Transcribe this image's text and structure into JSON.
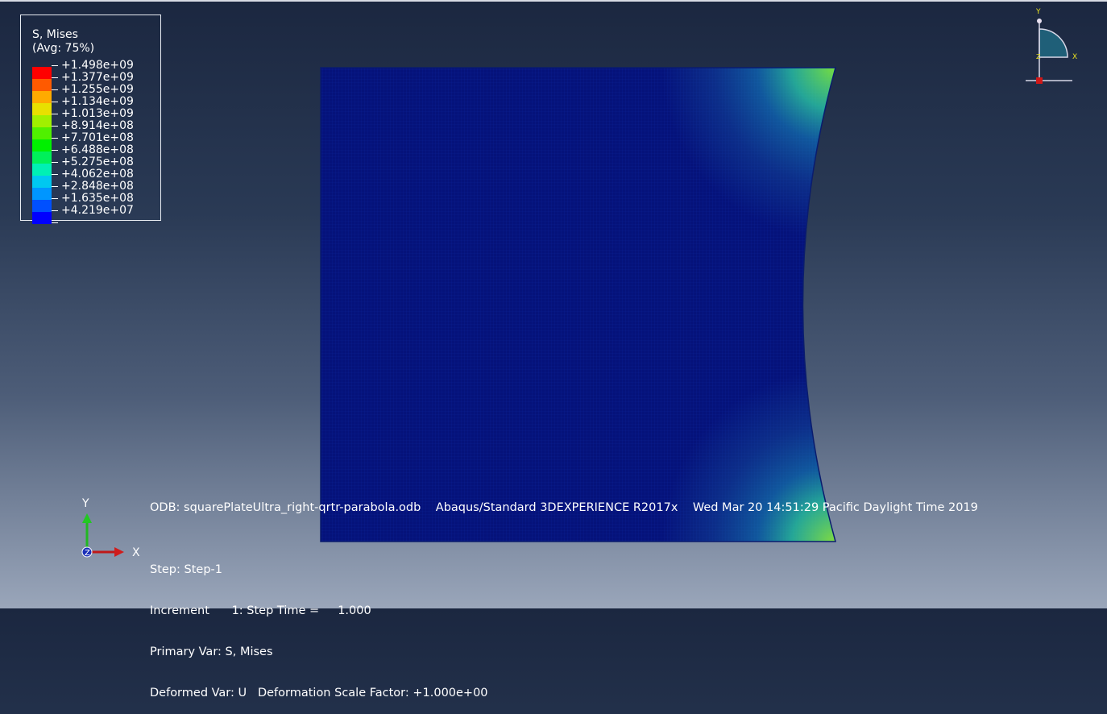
{
  "legend": {
    "title_line1": "S, Mises",
    "title_line2": "(Avg: 75%)",
    "values": [
      "+1.498e+09",
      "+1.377e+09",
      "+1.255e+09",
      "+1.134e+09",
      "+1.013e+09",
      "+8.914e+08",
      "+7.701e+08",
      "+6.488e+08",
      "+5.275e+08",
      "+4.062e+08",
      "+2.848e+08",
      "+1.635e+08",
      "+4.219e+07"
    ],
    "colors": [
      "#ff0000",
      "#ff5a00",
      "#ffaa00",
      "#e8e000",
      "#a0f000",
      "#50f000",
      "#00f000",
      "#00f05a",
      "#00f0b4",
      "#00c8f0",
      "#0096ff",
      "#0050ff",
      "#0000ff"
    ]
  },
  "info": {
    "odb_line": "ODB: squarePlateUltra_right-qrtr-parabola.odb    Abaqus/Standard 3DEXPERIENCE R2017x    Wed Mar 20 14:51:29 Pacific Daylight Time 2019",
    "step": "Step: Step-1",
    "increment": "Increment      1: Step Time =     1.000",
    "primary_var": "Primary Var: S, Mises",
    "deformed_var": "Deformed Var: U   Deformation Scale Factor: +1.000e+00"
  },
  "triad": {
    "y_label": "Y",
    "x_label": "X",
    "z_label": "Z"
  },
  "compass": {
    "y_label": "Y",
    "x_label": "X",
    "z_label": "Z"
  },
  "colors": {
    "mesh_base": "#05127a",
    "mesh_line": "#0a1f9a"
  }
}
